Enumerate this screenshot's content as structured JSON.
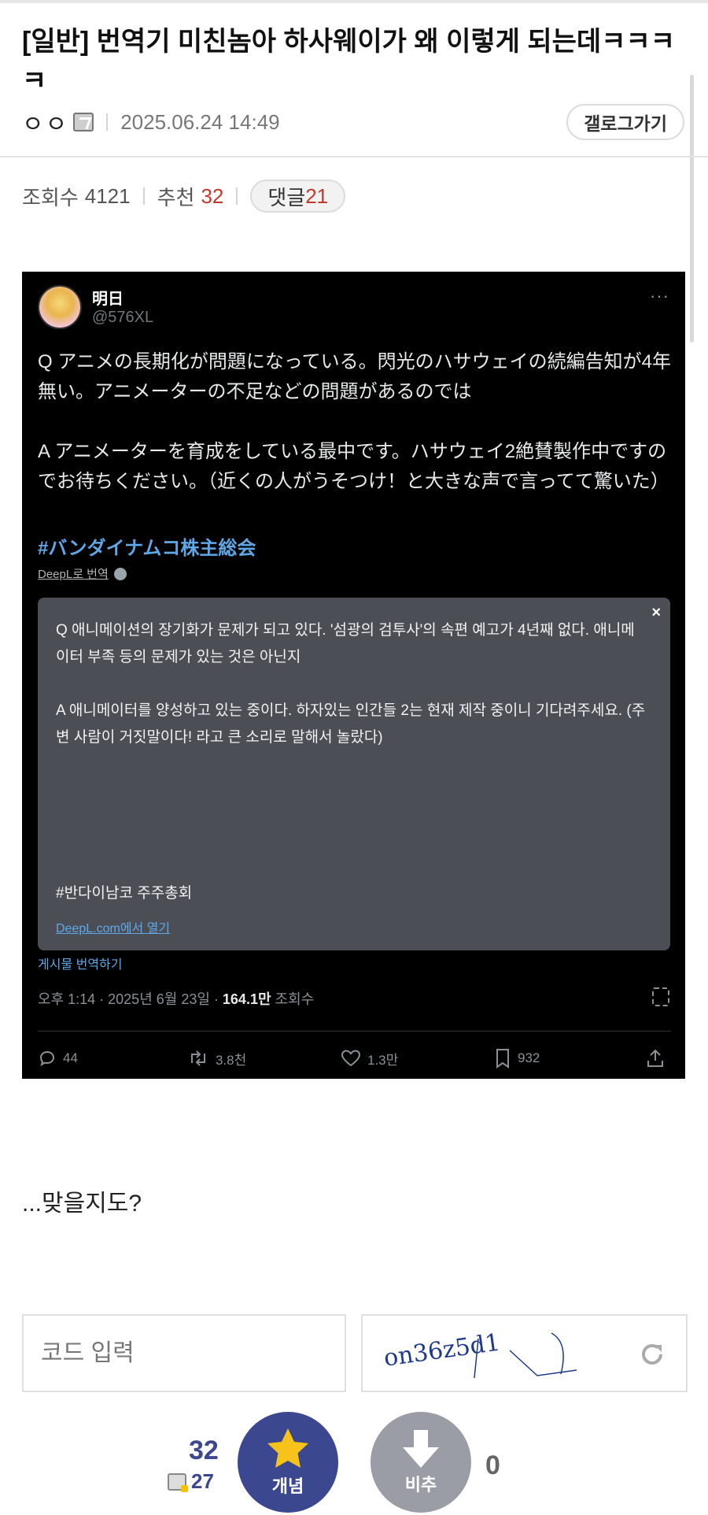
{
  "post": {
    "title": "[일반] 번역기 미친놈아 하사웨이가 왜 이렇게 되는데ㅋㅋㅋㅋ",
    "author": "ㅇㅇ",
    "date": "2025.06.24 14:49",
    "gallery_button": "갤로그가기"
  },
  "stats": {
    "views_label": "조회수",
    "views": "4121",
    "recommend_label": "추천",
    "recommend": "32",
    "comments_label": "댓글",
    "comments": "21"
  },
  "tweet": {
    "name": "明日",
    "handle": "@576XL",
    "more": "···",
    "paragraph_q": "Q アニメの長期化が問題になっている。閃光のハサウェイの続編告知が4年無い。アニメーターの不足などの問題があるのでは",
    "paragraph_a": "A アニメーターを育成をしている最中です。ハサウェイ2絶賛製作中ですのでお待ちください。（近くの人がうそつけ！と大きな声で言ってて驚いた）",
    "hashtag": "#バンダイナムコ株主総会",
    "deepl_label": "DeepL로 번역",
    "translation": {
      "close": "×",
      "paragraph_q": "Q 애니메이션의 장기화가 문제가 되고 있다. '섬광의 검투사'의 속편 예고가 4년째 없다. 애니메이터 부족 등의 문제가 있는 것은 아닌지",
      "paragraph_a": "A 애니메이터를 양성하고 있는 중이다. 하자있는 인간들 2는 현재 제작 중이니 기다려주세요. (주변 사람이 거짓말이다! 라고 큰 소리로 말해서 놀랐다)",
      "hashtag": "#반다이남코 주주총회",
      "link": "DeepL.com에서 열기"
    },
    "translate_post": "게시물 번역하기",
    "meta_time": "오후 1:14 · 2025년 6월 23일 · ",
    "meta_views": "164.1만",
    "meta_views_label": " 조회수",
    "actions": {
      "replies": "44",
      "retweets": "3.8천",
      "likes": "1.3만",
      "bookmarks": "932"
    }
  },
  "body_text": "...맞을지도?",
  "captcha": {
    "placeholder": "코드 입력",
    "image_text": "on36z5d1"
  },
  "vote": {
    "up_count": "32",
    "up_fixed_count": "27",
    "up_label": "개념",
    "down_label": "비추",
    "down_count": "0"
  },
  "colors": {
    "accent": "#3b4890",
    "highlight_red": "#c0392b",
    "tweet_bg": "#000000",
    "translation_bg": "#4b4f55",
    "link_blue": "#5fa8e8"
  }
}
